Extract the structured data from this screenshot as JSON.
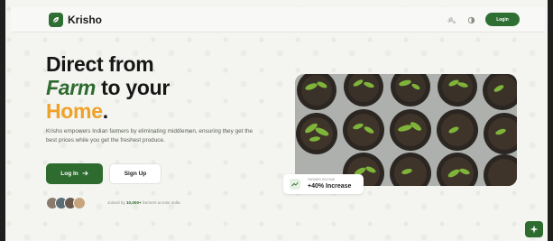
{
  "brand": {
    "name": "Krisho",
    "logo_icon": "leaf-icon",
    "primary_color": "#2e6b2f",
    "accent_color": "#f0a128"
  },
  "nav": {
    "language_icon": "translate-icon",
    "theme_icon": "theme-toggle-icon",
    "login_label": "Login"
  },
  "hero": {
    "headline_line1": "Direct from",
    "headline_farm": "Farm",
    "headline_to_your": " to your",
    "headline_home": "Home",
    "headline_period": ".",
    "description": "Krisho empowers Indian farmers by eliminating middlemen, ensuring they get the best prices while you get the freshest produce.",
    "primary_cta": "Log In",
    "primary_cta_icon": "arrow-right-icon",
    "secondary_cta": "Sign Up",
    "joined_prefix": "Joined by ",
    "joined_count": "10,000+",
    "joined_suffix": " farmers across India"
  },
  "stat": {
    "label": "FARMER INCOME",
    "value": "+40% Increase",
    "icon": "trend-up-icon"
  },
  "floating_button_icon": "sparkle-icon"
}
